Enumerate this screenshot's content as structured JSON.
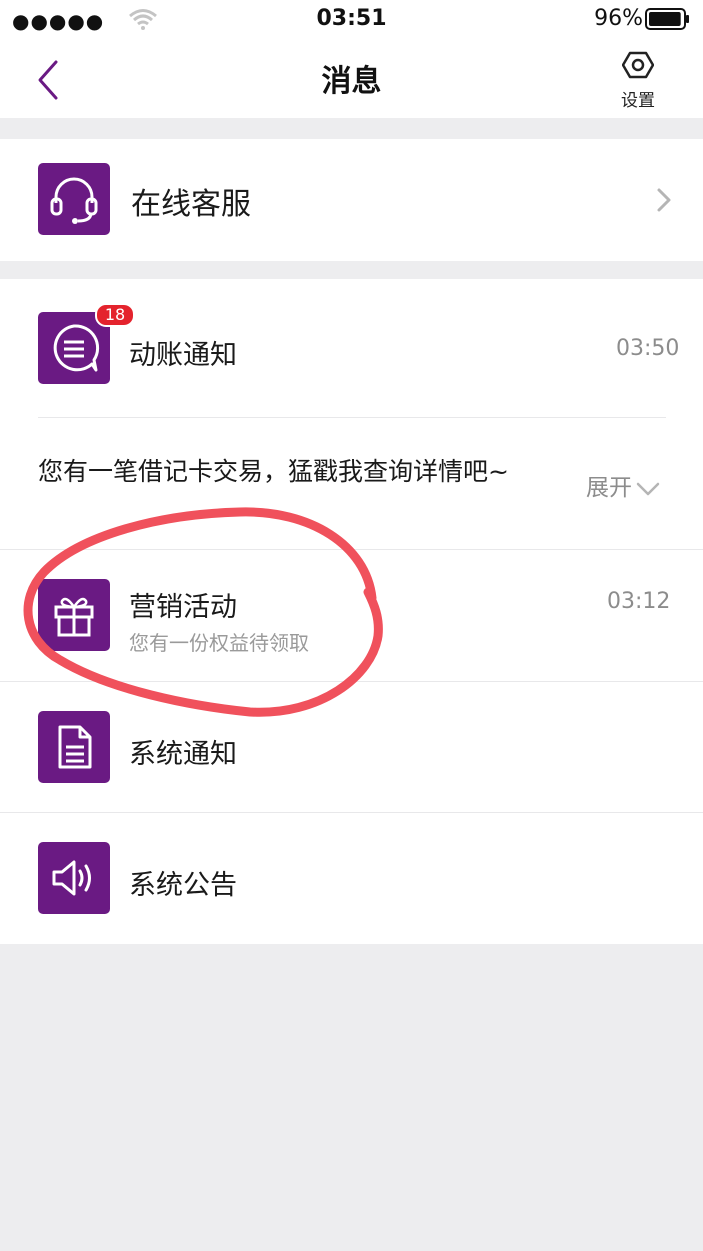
{
  "status_bar": {
    "signal": "●●●●●",
    "time": "03:51",
    "battery_percent": "96%",
    "battery_level": 0.96
  },
  "nav": {
    "back_icon": "chevron-left-icon",
    "title": "消息",
    "settings_label": "设置",
    "settings_icon": "hexagon-gear-icon"
  },
  "service": {
    "icon": "headset-icon",
    "title": "在线客服",
    "chevron": "chevron-right-icon"
  },
  "messages": [
    {
      "icon": "chat-bubble-icon",
      "title": "动账通知",
      "time": "03:50",
      "badge": "18",
      "preview": "您有一笔借记卡交易，猛戳我查询详情吧~",
      "expand_label": "展开"
    },
    {
      "icon": "gift-icon",
      "title": "营销活动",
      "subtitle": "您有一份权益待领取",
      "time": "03:12"
    },
    {
      "icon": "document-icon",
      "title": "系统通知"
    },
    {
      "icon": "speaker-icon",
      "title": "系统公告"
    }
  ],
  "colors": {
    "brand_purple": "#6a1a83",
    "badge_red": "#e4232d",
    "annotation_red": "#f0515c",
    "background_gray": "#ededef"
  }
}
